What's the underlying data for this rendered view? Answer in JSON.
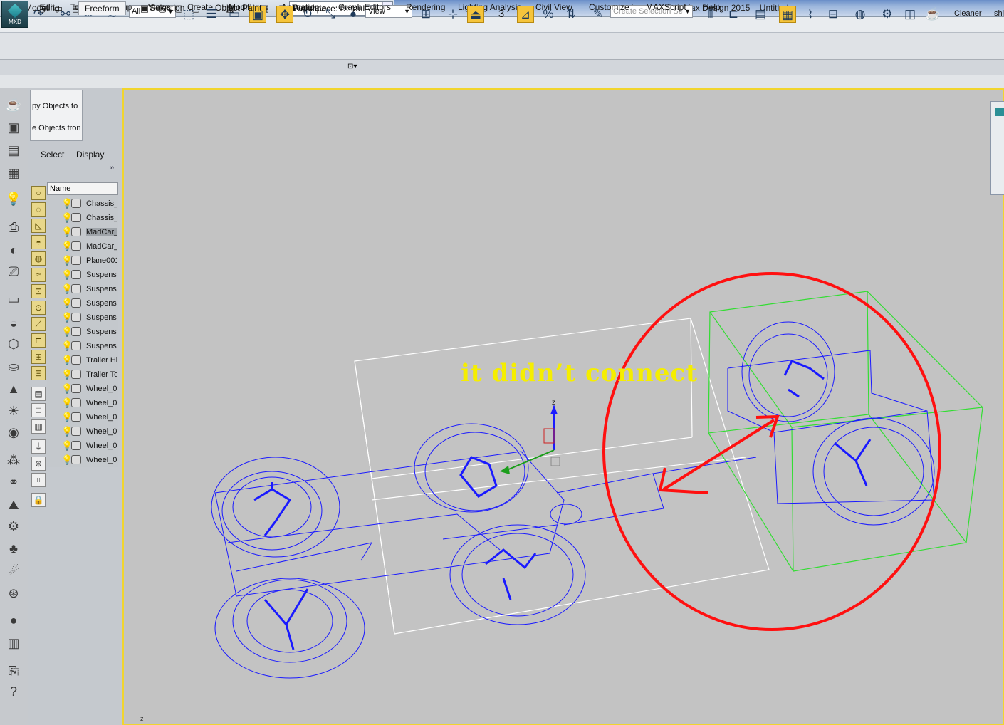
{
  "titlebar": {
    "app_logo_label": "MXD",
    "workspace": "Workspace: Default",
    "app_title": "Autodesk 3ds Max Design 2015",
    "document_title": "Untitled",
    "quick_access_icons": [
      "new-file-icon",
      "open-file-icon",
      "save-icon",
      "undo-icon",
      "redo-icon",
      "project-folder-icon",
      "window-icon",
      "window-icon",
      "window-icon",
      "render-icon",
      "grid-icon",
      "window-icon"
    ]
  },
  "menu": {
    "items": [
      "Edit",
      "Tools",
      "Group",
      "Views",
      "Create",
      "Modifiers",
      "Animation",
      "Graph Editors",
      "Rendering",
      "Lighting Analysis",
      "Civil View",
      "Customize",
      "MAXScript",
      "Help"
    ]
  },
  "toolbar": {
    "selection_filter": "All",
    "reference_coord": "View",
    "named_selection_placeholder": "Create Selection Se",
    "snap_label": "3",
    "cleaner_label": "Cleaner",
    "cut_label": "shi"
  },
  "ribbon": {
    "tabs": [
      "Modeling",
      "Freeform",
      "Selection",
      "Object Paint",
      "Populate"
    ],
    "active_tab": "Freeform"
  },
  "explorer": {
    "ops": [
      "py Objects to",
      "e Objects fron"
    ],
    "tabs": [
      "Select",
      "Display"
    ],
    "more": "»",
    "column_name": "Name",
    "rows": [
      {
        "label": "Chassis_(",
        "selected": false
      },
      {
        "label": "Chassis_(",
        "selected": false
      },
      {
        "label": "MadCar_",
        "selected": true
      },
      {
        "label": "MadCar_",
        "selected": false
      },
      {
        "label": "Plane001",
        "selected": false
      },
      {
        "label": "Suspensi",
        "selected": false
      },
      {
        "label": "Suspensi",
        "selected": false
      },
      {
        "label": "Suspensi",
        "selected": false
      },
      {
        "label": "Suspensi",
        "selected": false
      },
      {
        "label": "Suspensi",
        "selected": false
      },
      {
        "label": "Suspensi",
        "selected": false
      },
      {
        "label": "Trailer Hi",
        "selected": false
      },
      {
        "label": "Trailer To",
        "selected": false
      },
      {
        "label": "Wheel_0(",
        "selected": false
      },
      {
        "label": "Wheel_0(",
        "selected": false
      },
      {
        "label": "Wheel_0(",
        "selected": false
      },
      {
        "label": "Wheel_0(",
        "selected": false
      },
      {
        "label": "Wheel_0(",
        "selected": false
      },
      {
        "label": "Wheel_0(",
        "selected": false
      }
    ]
  },
  "viewport": {
    "annotation": "it didn’t connect",
    "gizmo_axis_label": "z",
    "corner_axis_label": "z",
    "colors": {
      "frame": "#f1d52e",
      "wire": "#1a1aff",
      "box": "#ffffff",
      "selected_box": "#33dd33",
      "markup": "#ff1010",
      "annotation": "#f5ee00"
    }
  }
}
